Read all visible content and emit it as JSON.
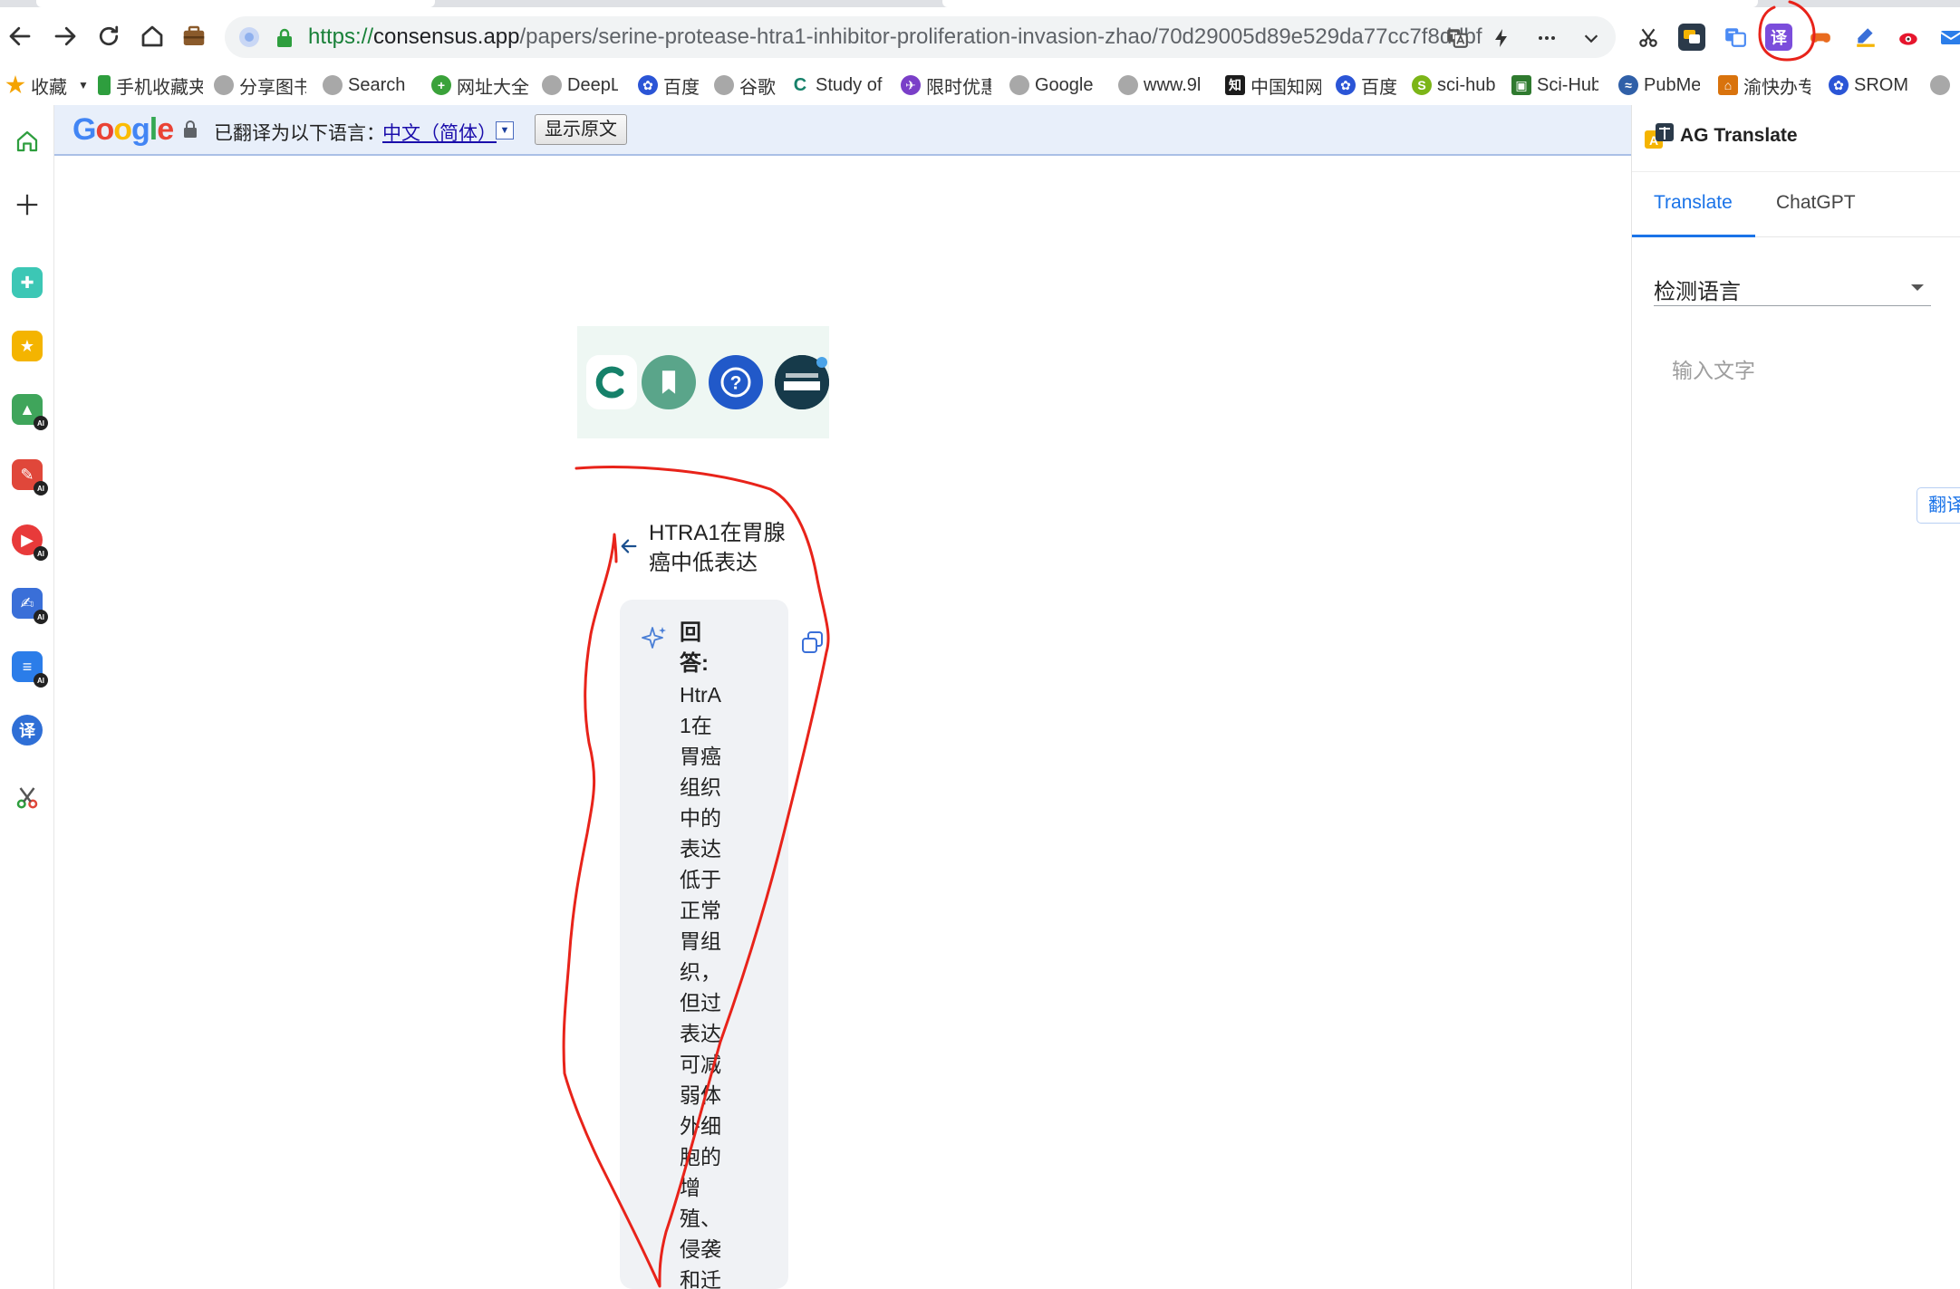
{
  "browser": {
    "url": {
      "protocol": "https://",
      "host": "consensus.app",
      "path": "/papers/serine-protease-htra1-inhibitor-proliferation-invasion-zhao/70d29005d89e529da77cc7f8ddbf"
    }
  },
  "bookmarks": [
    {
      "label": "收藏",
      "icon": "star-icon",
      "color": "#f4a300"
    },
    {
      "label": "手机收藏夹",
      "icon": "phone-icon",
      "color": "#2e9e3e"
    },
    {
      "label": "分享图书",
      "icon": "globe-icon",
      "color": "#8c8c8c"
    },
    {
      "label": "Search",
      "icon": "globe-icon",
      "color": "#8c8c8c"
    },
    {
      "label": "网址大全",
      "icon": "plus-circle-icon",
      "color": "#3aa23a"
    },
    {
      "label": "DeepL",
      "icon": "globe-icon",
      "color": "#8c8c8c"
    },
    {
      "label": "百度",
      "icon": "paw-icon",
      "color": "#2b55d6"
    },
    {
      "label": "谷歌",
      "icon": "globe-icon",
      "color": "#8c8c8c"
    },
    {
      "label": "Study of",
      "icon": "consensus-icon",
      "color": "#16816a"
    },
    {
      "label": "限时优惠",
      "icon": "plane-icon",
      "color": "#7a3fc8"
    },
    {
      "label": "Google",
      "icon": "globe-icon",
      "color": "#8c8c8c"
    },
    {
      "label": "www.9l",
      "icon": "globe-icon",
      "color": "#8c8c8c"
    },
    {
      "label": "中国知网",
      "icon": "cnki-icon",
      "color": "#1c1c1c"
    },
    {
      "label": "百度",
      "icon": "paw-icon",
      "color": "#2b55d6"
    },
    {
      "label": "sci-hub",
      "icon": "s-icon",
      "color": "#7cb518"
    },
    {
      "label": "Sci-Hub",
      "icon": "box-icon",
      "color": "#2f7a2f"
    },
    {
      "label": "PubMe",
      "icon": "pubmed-icon",
      "color": "#3060a8"
    },
    {
      "label": "渝快办专",
      "icon": "building-icon",
      "color": "#d9730d"
    },
    {
      "label": "SROM",
      "icon": "paw-icon",
      "color": "#2b55d6"
    }
  ],
  "gtbar": {
    "label": "已翻译为以下语言：",
    "language": "中文（简体）",
    "dropdown_glyph": "▼",
    "show_original": "显示原文"
  },
  "question": {
    "text": "HTRA1在胃腺癌中低表达"
  },
  "answer": {
    "title": "回答:",
    "body": "HtrA1在胃癌组织中的表达低于正常胃组织，但过表达可减弱体外细胞的增殖、侵袭和迁"
  },
  "side_panel": {
    "title": "AG Translate",
    "tabs": [
      "Translate",
      "ChatGPT"
    ],
    "active_tab": "Translate",
    "source_language": "检测语言",
    "input_placeholder": "输入文字",
    "translate_button": "翻译"
  },
  "colors": {
    "accent": "#1a73e8",
    "annotation": "#e8231a"
  }
}
